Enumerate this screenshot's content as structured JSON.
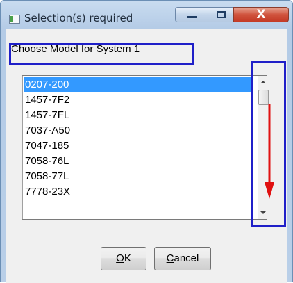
{
  "window": {
    "title": "Selection(s) required",
    "close_glyph": "X"
  },
  "prompt": {
    "label": "Choose Model for System 1"
  },
  "list": {
    "selected_index": 0,
    "items": [
      "0207-200",
      "1457-7F2",
      "1457-7FL",
      "7037-A50",
      "7047-185",
      "7058-76L",
      "7058-77L",
      "7778-23X"
    ]
  },
  "buttons": {
    "ok": {
      "mnemonic": "O",
      "rest": "K"
    },
    "cancel": {
      "mnemonic": "C",
      "rest": "ancel"
    }
  },
  "annotations": {
    "highlight_color": "#1f1fc8",
    "arrow_color": "#e01010"
  }
}
